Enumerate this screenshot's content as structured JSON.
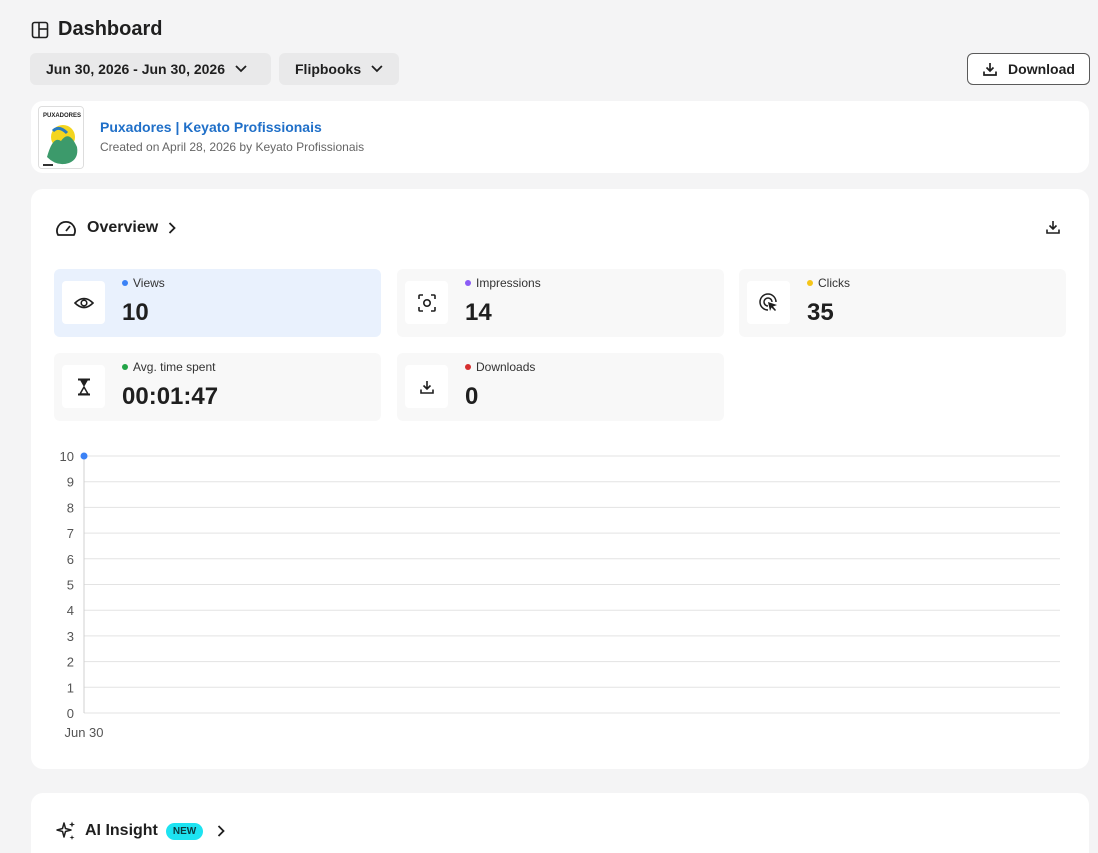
{
  "page": {
    "title": "Dashboard"
  },
  "filters": {
    "date_range": "Jun 30, 2026 - Jun 30, 2026",
    "content_type": "Flipbooks",
    "download_label": "Download"
  },
  "book": {
    "title": "Puxadores | Keyato Profissionais",
    "subtitle": "Created on April 28, 2026 by Keyato Profissionais",
    "thumb_text": "PUXADORES"
  },
  "overview": {
    "label": "Overview",
    "stats": [
      {
        "label": "Views",
        "value": "10",
        "dot_color": "#3b82f6",
        "icon": "eye-icon"
      },
      {
        "label": "Impressions",
        "value": "14",
        "dot_color": "#8b5cf6",
        "icon": "scan-icon"
      },
      {
        "label": "Clicks",
        "value": "35",
        "dot_color": "#f5c518",
        "icon": "cursor-click-icon"
      },
      {
        "label": "Avg. time spent",
        "value": "00:01:47",
        "dot_color": "#22a447",
        "icon": "hourglass-icon"
      },
      {
        "label": "Downloads",
        "value": "0",
        "dot_color": "#d62f2f",
        "icon": "download-icon"
      }
    ]
  },
  "chart_data": {
    "type": "line",
    "x": [
      "Jun 30"
    ],
    "series": [
      {
        "values": [
          10
        ],
        "color": "#3b82f6"
      }
    ],
    "y_ticks": [
      "0",
      "1",
      "2",
      "3",
      "4",
      "5",
      "6",
      "7",
      "8",
      "9",
      "10"
    ],
    "ylim": [
      0,
      10
    ],
    "grid": true
  },
  "ai": {
    "label": "AI Insight",
    "badge": "NEW"
  }
}
